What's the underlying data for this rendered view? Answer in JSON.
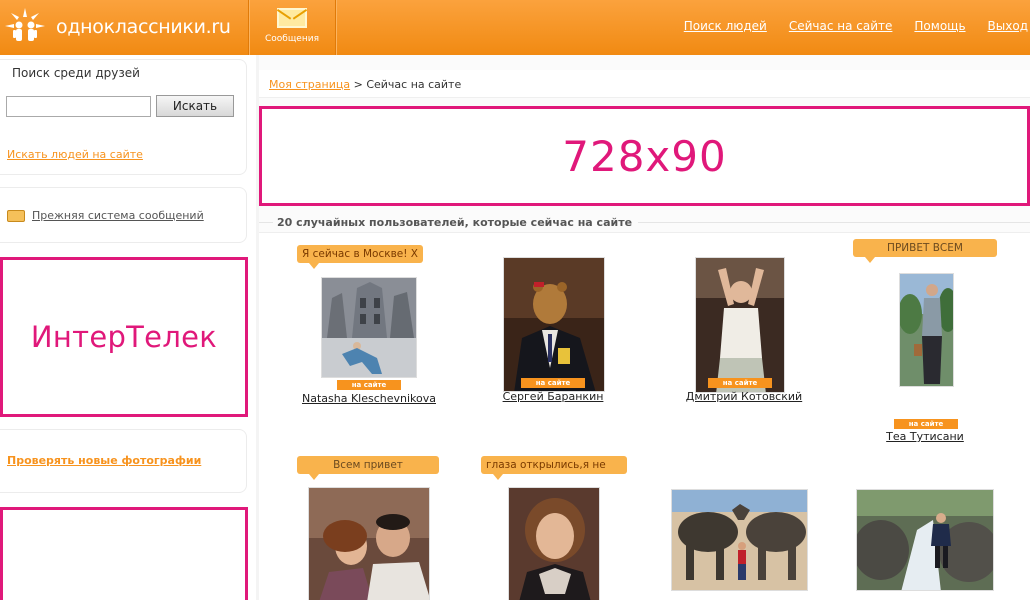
{
  "header": {
    "site_name": "одноклассники.ru",
    "messages_label": "Сообщения",
    "nav": [
      "Поиск людей",
      "Сейчас на сайте",
      "Помощь",
      "Выход"
    ]
  },
  "sidebar": {
    "search_title": "Поиск среди друзей",
    "search_placeholder": "",
    "search_button": "Искать",
    "search_people_link": "Искать людей на сайте",
    "old_messages_link": "Прежняя система сообщений",
    "ad_label": "ИнтерТелек",
    "new_photos_link": "Проверять новые фотографии"
  },
  "main": {
    "breadcrumb_home": "Моя страница",
    "breadcrumb_sep": " > ",
    "breadcrumb_current": "Сейчас на сайте",
    "ad_label": "728x90",
    "section_title": "20 случайных пользователей, которые сейчас на сайте",
    "users": [
      {
        "status": "Я сейчас в Москве! Х",
        "online": "на сайте",
        "name": "Natasha Kleschevnikova"
      },
      {
        "status": "",
        "online": "на сайте",
        "name": "Сергей Баранкин"
      },
      {
        "status": "",
        "online": "на сайте",
        "name": "Дмитрий Котовский"
      },
      {
        "status": "ПРИВЕТ ВСЕМ",
        "online": "на сайте",
        "name": "Тea Тутисани"
      },
      {
        "status": "Всем привет",
        "online": "",
        "name": ""
      },
      {
        "status": "глаза открылись,я не",
        "online": "",
        "name": ""
      },
      {
        "status": "",
        "online": "",
        "name": ""
      },
      {
        "status": "",
        "online": "",
        "name": ""
      }
    ]
  },
  "colors": {
    "brand_orange": "#f7931e",
    "ad_magenta": "#e0187a"
  }
}
